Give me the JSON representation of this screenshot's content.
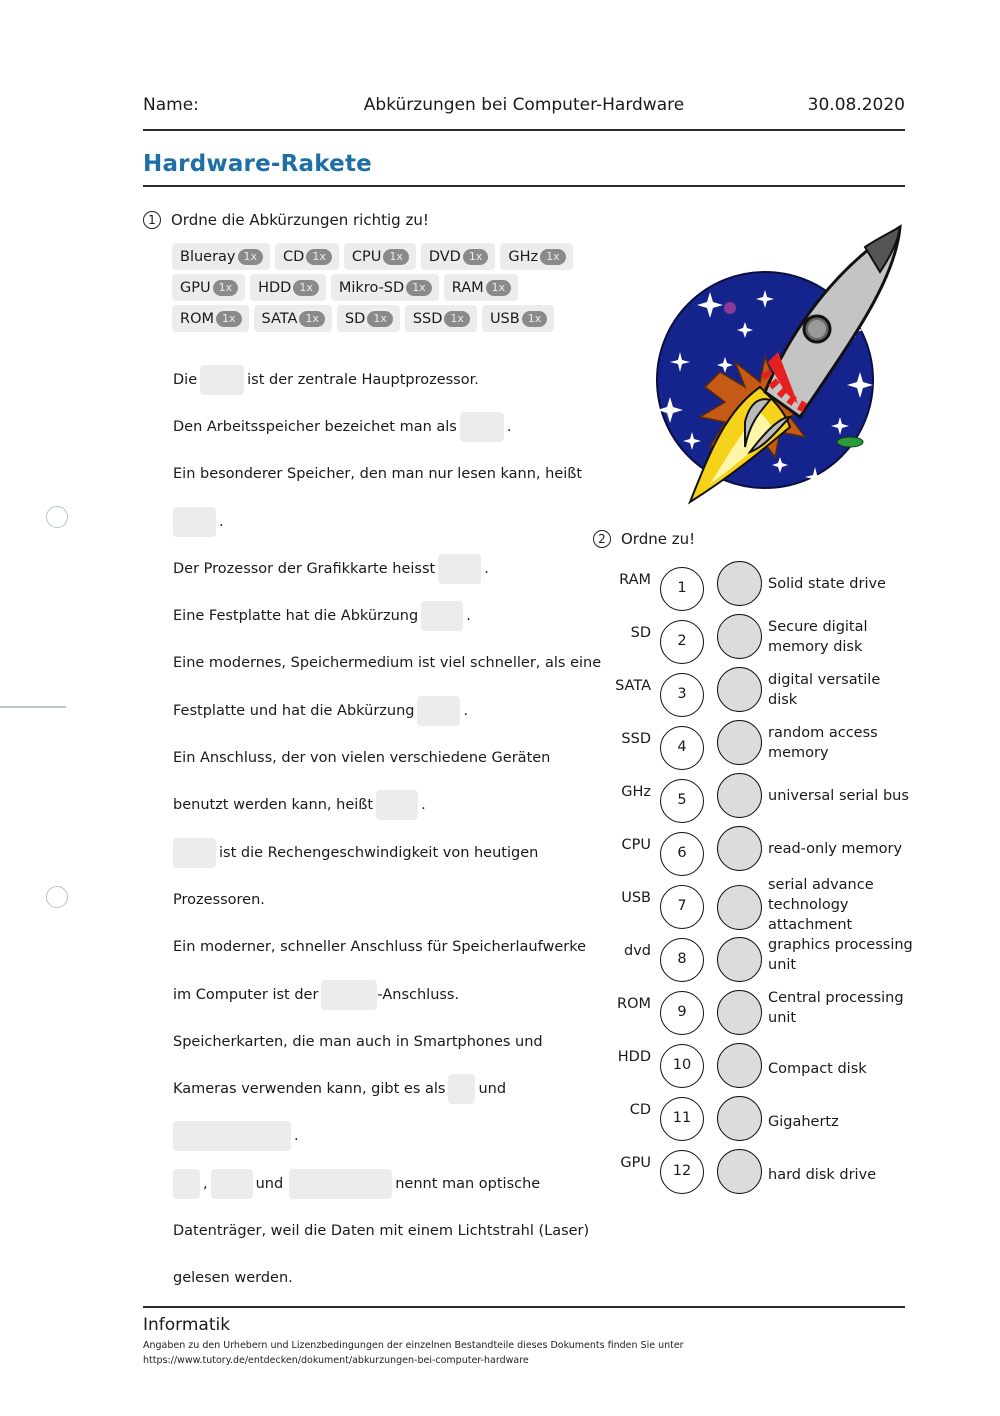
{
  "header": {
    "name_label": "Name:",
    "doc_title": "Abkürzungen bei Computer-Hardware",
    "date": "30.08.2020"
  },
  "title": "Hardware-Rakete",
  "task1": {
    "number": "1",
    "instruction": "Ordne die Abkürzungen richtig zu!",
    "chip_rows": [
      [
        {
          "label": "Blueray",
          "count": "1x"
        },
        {
          "label": "CD",
          "count": "1x"
        },
        {
          "label": "CPU",
          "count": "1x"
        },
        {
          "label": "DVD",
          "count": "1x"
        },
        {
          "label": "GHz",
          "count": "1x"
        }
      ],
      [
        {
          "label": "GPU",
          "count": "1x"
        },
        {
          "label": "HDD",
          "count": "1x"
        },
        {
          "label": "Mikro-SD",
          "count": "1x"
        },
        {
          "label": "RAM",
          "count": "1x"
        }
      ],
      [
        {
          "label": "ROM",
          "count": "1x"
        },
        {
          "label": "SATA",
          "count": "1x"
        },
        {
          "label": "SD",
          "count": "1x"
        },
        {
          "label": "SSD",
          "count": "1x"
        },
        {
          "label": "USB",
          "count": "1x"
        }
      ]
    ],
    "lines": [
      {
        "t1": "Die",
        "t2": "ist der zentrale Hauptprozessor."
      },
      {
        "t1": "Den Arbeitsspeicher bezeichet man als",
        "t2": "."
      },
      {
        "t1": "Ein besonderer Speicher, den man nur lesen kann, heißt"
      },
      {
        "t2": "."
      },
      {
        "t1": "Der Prozessor der Grafikkarte heisst",
        "t2": "."
      },
      {
        "t1": "Eine Festplatte hat die Abkürzung",
        "t2": "."
      },
      {
        "t1": "Eine modernes, Speichermedium ist viel schneller, als eine"
      },
      {
        "t1": "Festplatte und hat die Abkürzung",
        "t2": "."
      },
      {
        "t1": "Ein Anschluss, der von vielen verschiedene Geräten"
      },
      {
        "t1": "benutzt werden kann, heißt",
        "t2": "."
      },
      {
        "t2": "ist die Rechengeschwindigkeit von heutigen"
      },
      {
        "t1": "Prozessoren."
      },
      {
        "t1": "Ein moderner, schneller Anschluss für Speicherlaufwerke"
      },
      {
        "t1": "im Computer ist der",
        "t2": "-Anschluss."
      },
      {
        "t1": "Speicherkarten, die man auch in Smartphones und"
      },
      {
        "t1": "Kameras verwenden kann, gibt es als",
        "t2": "und"
      },
      {
        "t2": "."
      },
      {
        "t2": ",",
        "t3": "und",
        "t4": "nennt man optische"
      },
      {
        "t1": "Datenträger, weil die Daten mit einem Lichtstrahl (Laser)"
      },
      {
        "t1": "gelesen werden."
      }
    ]
  },
  "task2": {
    "number": "2",
    "instruction": "Ordne zu!",
    "rows": [
      {
        "abbr": "RAM",
        "num": "1",
        "definition": "Solid state drive"
      },
      {
        "abbr": "SD",
        "num": "2",
        "definition": "Secure digital memory disk"
      },
      {
        "abbr": "SATA",
        "num": "3",
        "definition": "digital versatile disk"
      },
      {
        "abbr": "SSD",
        "num": "4",
        "definition": "random access memory"
      },
      {
        "abbr": "GHz",
        "num": "5",
        "definition": "universal serial bus"
      },
      {
        "abbr": "CPU",
        "num": "6",
        "definition": "read-only memory"
      },
      {
        "abbr": "USB",
        "num": "7",
        "definition": "serial advance technology attachment"
      },
      {
        "abbr": "dvd",
        "num": "8",
        "definition": "graphics processing unit"
      },
      {
        "abbr": "ROM",
        "num": "9",
        "definition": "Central processing unit"
      },
      {
        "abbr": "HDD",
        "num": "10",
        "definition": "Compact disk"
      },
      {
        "abbr": "CD",
        "num": "11",
        "definition": "Gigahertz"
      },
      {
        "abbr": "GPU",
        "num": "12",
        "definition": "hard disk drive"
      }
    ]
  },
  "image": {
    "icon": "rocket-illustration"
  },
  "footer": {
    "subject": "Informatik",
    "license_line1": "Angaben zu den Urhebern und Lizenzbedingungen der einzelnen Bestandteile dieses Dokuments finden Sie unter",
    "license_line2": "https://www.tutory.de/entdecken/dokument/abkurzungen-bei-computer-hardware"
  },
  "colors": {
    "title": "#1d6fa5",
    "chip_bg": "#ececec",
    "badge_bg": "#8a8a8a",
    "dot_fill": "#dcdcdc"
  }
}
